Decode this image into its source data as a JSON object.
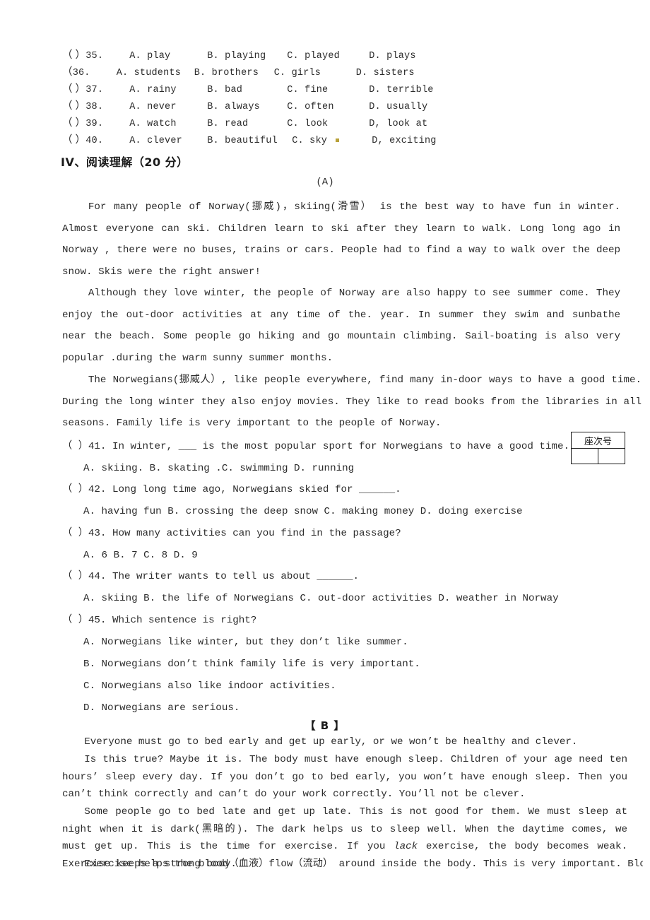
{
  "cloze": {
    "rows": [
      {
        "paren": "（ ）",
        "num": "35.",
        "a": "A. play",
        "b": "B. playing",
        "c": "C. played",
        "d": "D. plays"
      },
      {
        "paren": "（  ",
        "num": "36.",
        "a": "A. students",
        "b": "B. brothers",
        "c": "C. girls",
        "d": "D. sisters"
      },
      {
        "paren": "（ ）",
        "num": "37.",
        "a": "A. rainy",
        "b": "B. bad",
        "c": "C. fine",
        "d": "D. terrible"
      },
      {
        "paren": "（ ）",
        "num": "38.",
        "a": "A. never",
        "b": "B. always",
        "c": "C. often",
        "d": "D. usually"
      },
      {
        "paren": "（ ）",
        "num": "39.",
        "a": "A. watch",
        "b": "B. read",
        "c": "C.  look",
        "d": "D, look at"
      },
      {
        "paren": "（ ）",
        "num": "40.",
        "a": "A. clever",
        "b": "B. beautiful",
        "c": "C. sky",
        "d": "D, exciting"
      }
    ]
  },
  "section": {
    "heading": "IV、阅读理解（20 分）"
  },
  "passage_a": {
    "label": "(A)",
    "p1": "For many people of Norway(挪威)，skiing(滑雪） is the best way to have fun in winter. Almost everyone can ski. Children learn to ski after they learn to walk. Long long ago in Norway , there were no buses, trains or cars. People had to find a way to walk over the deep snow. Skis were the right answer!",
    "p2": "Although they love winter, the people of Norway are also happy to see summer come. They enjoy the out-door activities at any time of the. year. In summer they swim and sunbathe near the beach. Some people go hiking and go mountain climbing. Sail-boating is also very popular .during the warm sunny summer months.",
    "p3": "The Norwegians(挪威人）, like people everywhere, find many in-door ways to have a good time. During the long winter they also enjoy movies. They like to read books from the libraries in all seasons. Family life is very important to the people of Norway."
  },
  "questions": [
    {
      "id": "41",
      "stem": "（  ）41. In winter,  ___ is the most popular sport for Norwegians to have a good time.",
      "options": "A. skiing.    B. skating  .C. swimming   D. running"
    },
    {
      "id": "42",
      "stem": "（  ）42. Long long time ago, Norwegians skied for  ______.",
      "options": "A. having fun  B. crossing the deep snow    C. making money   D. doing exercise"
    },
    {
      "id": "43",
      "stem": "（  ）43. How many activities can you find in the passage?",
      "options": "A. 6        B. 7     C. 8      D. 9"
    },
    {
      "id": "44",
      "stem": "（  ）44. The writer wants to tell us about ______.",
      "options": "A. skiing  B. the life of Norwegians    C. out-door activities  D. weather in Norway"
    },
    {
      "id": "45",
      "stem": "（  ）45. Which sentence is right?",
      "options": ""
    }
  ],
  "q45_options": {
    "a": "A. Norwegians like winter, but they don’t like summer.",
    "b": "B. Norwegians don’t think family life is very important.",
    "c": "C. Norwegians also like indoor activities.",
    "d": "D. Norwegians are serious."
  },
  "seat_table": {
    "header": "座次号",
    "cell_left": "",
    "cell_right": ""
  },
  "passage_b": {
    "label": "【 B 】",
    "p1": "Everyone must go to bed early and get up early, or we won’t be healthy and clever.",
    "p2": "Is this true? Maybe it is. The body must have enough sleep. Children of your age need ten hours’ sleep every day. If you don’t go to bed early, you won’t have enough sleep. Then you can’t think correctly and can’t do your work correctly. You’ll not be clever.",
    "p3_part1": "Some people go to bed late and get up late. This is not good for them. We must sleep at night when it is dark(黑暗的). The dark helps us to sleep well. When the daytime comes, we must get up. This is the time for exercise. If you ",
    "p3_italic": "lack",
    "p3_part2": " exercise, the body becomes weak. Exercise keeps a strong body.",
    "p4": "Exercise helps the blood（血液）flow（流动） around inside the body. This is very important. Blood"
  }
}
